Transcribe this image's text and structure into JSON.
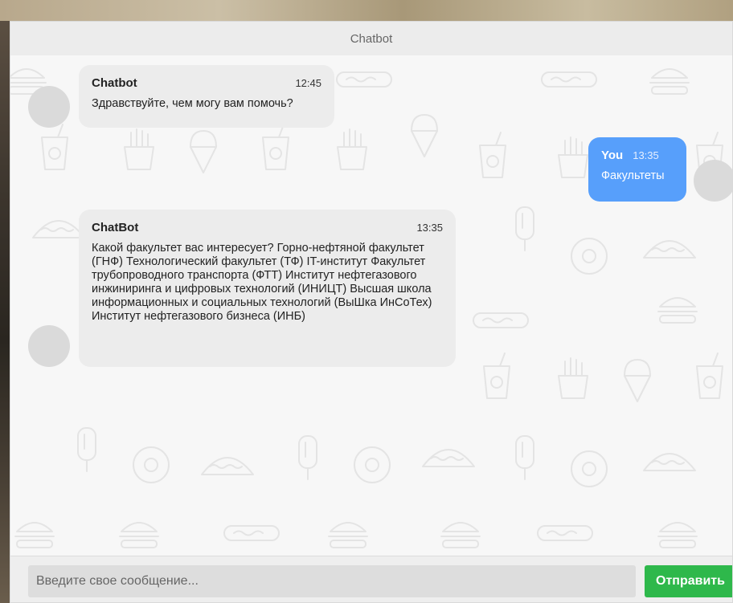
{
  "header": {
    "title": "Chatbot"
  },
  "messages": [
    {
      "sender": "Chatbot",
      "time": "12:45",
      "text": "Здравствуйте, чем могу вам помочь?",
      "side": "left"
    },
    {
      "sender": "You",
      "time": "13:35",
      "text": "Факультеты",
      "side": "right"
    },
    {
      "sender": "ChatBot",
      "time": "13:35",
      "text": "Какой факультет вас интересует? Горно-нефтяной факультет (ГНФ) Технологический факультет (ТФ) IT-институт Факультет трубопроводного транспорта (ФТТ) Институт нефтегазового инжиниринга и цифровых технологий (ИНИЦТ) Высшая школа информационных и социальных технологий (ВыШка ИнСоТех) Институт нефтегазового бизнеса (ИНБ)",
      "side": "left"
    }
  ],
  "input": {
    "placeholder": "Введите свое сообщение...",
    "value": ""
  },
  "send_button": {
    "label": "Отправить"
  },
  "colors": {
    "user_bubble": "#579ffb",
    "bot_bubble": "#ececec",
    "send_button": "#2eb84b",
    "header_bg": "#ececec"
  },
  "icons": [
    "burger-icon",
    "hotdog-icon",
    "soda-cup-icon",
    "fries-icon",
    "ice-cream-icon",
    "donut-icon",
    "taco-icon",
    "popsicle-icon"
  ]
}
